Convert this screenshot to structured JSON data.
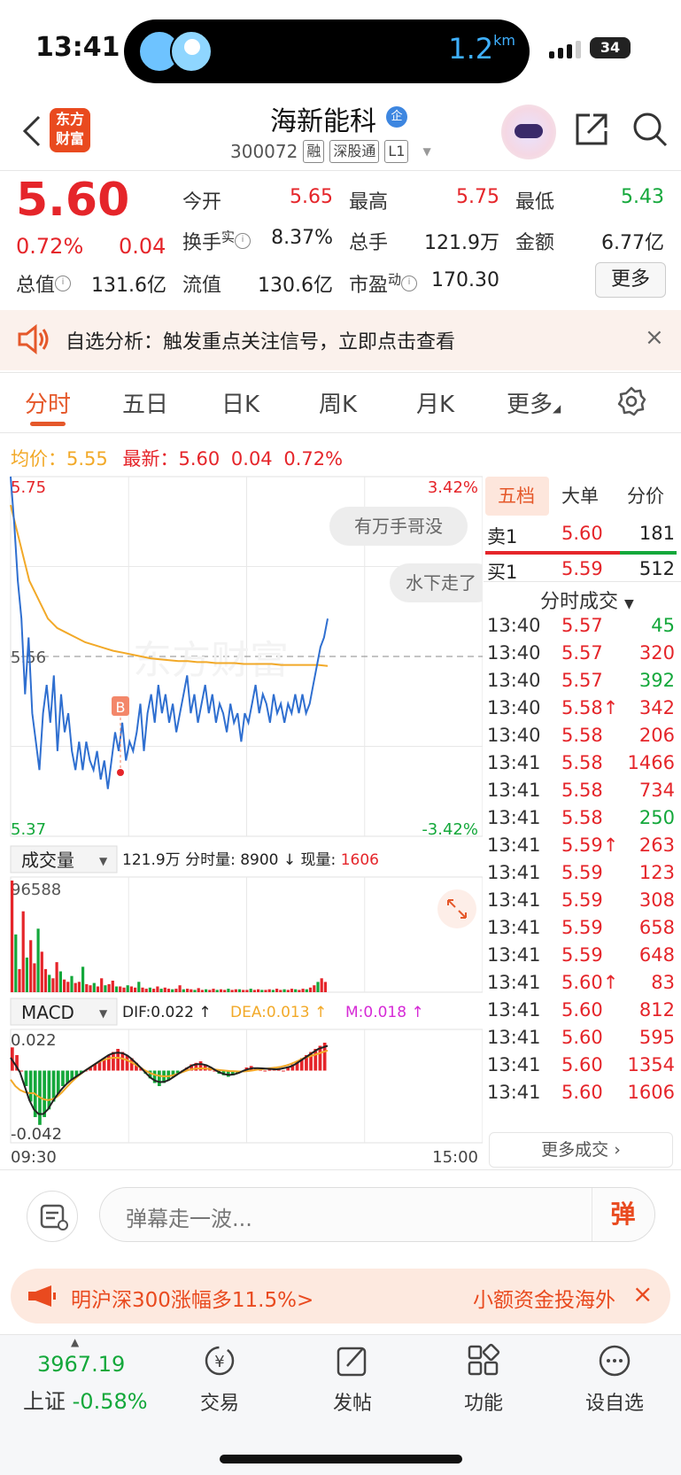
{
  "status_bar": {
    "time": "13:41",
    "distance": "1.2",
    "distance_unit": "km",
    "battery": "34"
  },
  "header": {
    "logo_text_1": "东方",
    "logo_text_2": "财富",
    "stock_name": "海新能科",
    "badge": "企",
    "stock_code": "300072",
    "tags": [
      "融",
      "深股通",
      "L1"
    ]
  },
  "quote": {
    "price": "5.60",
    "change_pct": "0.72%",
    "change_abs": "0.04",
    "open_label": "今开",
    "open": "5.65",
    "high_label": "最高",
    "high": "5.75",
    "low_label": "最低",
    "low": "5.43",
    "turnover_label": "换手",
    "turnover_sup": "实",
    "turnover": "8.37%",
    "volume_label": "总手",
    "volume": "121.9万",
    "amount_label": "金额",
    "amount": "6.77亿",
    "mktcap_label": "总值",
    "mktcap": "131.6亿",
    "float_label": "流值",
    "float": "130.6亿",
    "pe_label": "市盈",
    "pe_sup": "动",
    "pe": "170.30",
    "more_label": "更多"
  },
  "announcement": {
    "text": "自选分析：触发重点关注信号，立即点击查看",
    "close": "×"
  },
  "tabs": [
    "分时",
    "五日",
    "日K",
    "周K",
    "月K",
    "更多"
  ],
  "avg_line": {
    "avg_label": "均价：",
    "avg_value": "5.55",
    "latest_label": "最新：",
    "latest_value": "5.60",
    "latest_chg": "0.04",
    "latest_pct": "0.72%"
  },
  "chart_labels": {
    "price_top": "5.75",
    "price_mid": "5.56",
    "price_bottom": "5.37",
    "pct_top": "3.42%",
    "pct_bottom": "-3.42%",
    "danmu_1": "有万手哥没",
    "danmu_2": "水下走了",
    "watermark": "东方财富",
    "buy_marker": "B",
    "vol_selector": "成交量",
    "vol_total": "121.9万",
    "vol_fen_label": "分时量:",
    "vol_fen_value": "8900",
    "vol_now_label": "现量:",
    "vol_now_value": "1606",
    "vol_max": "96588",
    "macd_selector": "MACD",
    "dif": "DIF:0.022 ↑",
    "dea": "DEA:0.013 ↑",
    "m": "M:0.018 ↑",
    "macd_top": "0.022",
    "macd_bottom": "-0.042",
    "time_start": "09:30",
    "time_end": "15:00"
  },
  "order_book": {
    "tabs": [
      "五档",
      "大单",
      "分价"
    ],
    "sell1": {
      "label": "卖1",
      "price": "5.60",
      "volume": "181"
    },
    "buy1": {
      "label": "买1",
      "price": "5.59",
      "volume": "512"
    },
    "trades_title": "分时成交",
    "trades": [
      {
        "time": "13:40",
        "price": "5.57",
        "volume": "45",
        "dir": "sell"
      },
      {
        "time": "13:40",
        "price": "5.57",
        "volume": "320",
        "dir": "buy"
      },
      {
        "time": "13:40",
        "price": "5.57",
        "volume": "392",
        "dir": "sell"
      },
      {
        "time": "13:40",
        "price": "5.58↑",
        "volume": "342",
        "dir": "buy"
      },
      {
        "time": "13:40",
        "price": "5.58",
        "volume": "206",
        "dir": "buy"
      },
      {
        "time": "13:41",
        "price": "5.58",
        "volume": "1466",
        "dir": "buy"
      },
      {
        "time": "13:41",
        "price": "5.58",
        "volume": "734",
        "dir": "buy"
      },
      {
        "time": "13:41",
        "price": "5.58",
        "volume": "250",
        "dir": "sell"
      },
      {
        "time": "13:41",
        "price": "5.59↑",
        "volume": "263",
        "dir": "buy"
      },
      {
        "time": "13:41",
        "price": "5.59",
        "volume": "123",
        "dir": "buy"
      },
      {
        "time": "13:41",
        "price": "5.59",
        "volume": "308",
        "dir": "buy"
      },
      {
        "time": "13:41",
        "price": "5.59",
        "volume": "658",
        "dir": "buy"
      },
      {
        "time": "13:41",
        "price": "5.59",
        "volume": "648",
        "dir": "buy"
      },
      {
        "time": "13:41",
        "price": "5.60↑",
        "volume": "83",
        "dir": "buy"
      },
      {
        "time": "13:41",
        "price": "5.60",
        "volume": "812",
        "dir": "buy"
      },
      {
        "time": "13:41",
        "price": "5.60",
        "volume": "595",
        "dir": "buy"
      },
      {
        "time": "13:41",
        "price": "5.60",
        "volume": "1354",
        "dir": "buy"
      },
      {
        "time": "13:41",
        "price": "5.60",
        "volume": "1606",
        "dir": "buy"
      }
    ],
    "more_trades": "更多成交 ›"
  },
  "danmu": {
    "placeholder": "弹幕走一波...",
    "send": "弹"
  },
  "promo": {
    "text1": "明沪深300涨幅多11.5%>",
    "text2": "小额资金投海外",
    "close": "×"
  },
  "bottom_nav": {
    "index_value": "3967.19",
    "index_name": "上证",
    "index_change": "-0.58%",
    "items": [
      "交易",
      "发帖",
      "功能",
      "设自选"
    ]
  },
  "colors": {
    "up": "#e5252a",
    "down": "#14a83b",
    "price_line": "#2f6fd0",
    "avg_line": "#f2a928",
    "accent": "#e5582a"
  },
  "chart_data": [
    {
      "type": "line",
      "title": "",
      "x_label_start": "09:30",
      "x_label_end": "15:00",
      "ylim": [
        5.37,
        5.75
      ],
      "prev_close": 5.56,
      "series": [
        {
          "values": [
            5.75,
            5.7,
            5.64,
            5.6,
            5.52,
            5.58,
            5.5,
            5.47,
            5.44,
            5.5,
            5.53,
            5.49,
            5.54,
            5.46,
            5.52,
            5.48,
            5.5,
            5.46,
            5.44,
            5.47,
            5.44,
            5.47,
            5.45,
            5.44,
            5.46,
            5.43,
            5.45,
            5.42,
            5.45,
            5.48,
            5.46,
            5.49,
            5.45,
            5.47,
            5.46,
            5.48,
            5.51,
            5.46,
            5.5,
            5.52,
            5.49,
            5.53,
            5.5,
            5.52,
            5.49,
            5.51,
            5.48,
            5.5,
            5.52,
            5.54,
            5.5,
            5.52,
            5.49,
            5.51,
            5.53,
            5.5,
            5.52,
            5.49,
            5.51,
            5.5,
            5.48,
            5.51,
            5.49,
            5.5,
            5.47,
            5.5,
            5.49,
            5.51,
            5.53,
            5.5,
            5.52,
            5.51,
            5.49,
            5.52,
            5.5,
            5.51,
            5.49,
            5.51,
            5.5,
            5.52,
            5.5,
            5.52,
            5.5,
            5.51,
            5.53,
            5.55,
            5.57,
            5.58,
            5.6
          ]
        },
        {
          "values": [
            5.72,
            5.68,
            5.64,
            5.62,
            5.6,
            5.59,
            5.585,
            5.58,
            5.575,
            5.572,
            5.569,
            5.566,
            5.564,
            5.562,
            5.56,
            5.558,
            5.557,
            5.556,
            5.555,
            5.555,
            5.554,
            5.554,
            5.553,
            5.553,
            5.553,
            5.552,
            5.552,
            5.552,
            5.552,
            5.551,
            5.551,
            5.551,
            5.551,
            5.551,
            5.55
          ]
        }
      ]
    },
    {
      "type": "bar",
      "title": "",
      "ylim": [
        0,
        96588
      ],
      "values": [
        96588,
        50000,
        20000,
        70000,
        30000,
        45000,
        25000,
        55000,
        35000,
        20000,
        15000,
        12000,
        26000,
        18000,
        11000,
        9000,
        14000,
        8000,
        9000,
        22000,
        7000,
        6000,
        8000,
        5000,
        12000,
        6000,
        7000,
        10000,
        5000,
        5000,
        4000,
        6000,
        5000,
        4000,
        9000,
        4000,
        3000,
        4000,
        3000,
        5000,
        3000,
        4000,
        3000,
        2500,
        3000,
        6000,
        2500,
        3000,
        2500,
        2000,
        3500,
        2000,
        2500,
        2000,
        3000,
        2000,
        2500,
        2000,
        3000,
        2000,
        2500,
        2500,
        2000,
        2000,
        3000,
        2000,
        2500,
        2000,
        2000,
        2500,
        2000,
        3000,
        2000,
        2500,
        2000,
        3000,
        2500,
        2000,
        3000,
        2500,
        4000,
        6000,
        8900,
        12000,
        8900
      ]
    },
    {
      "type": "bar",
      "title": "",
      "ylim": [
        -0.042,
        0.022
      ],
      "values": [
        0.015,
        0.01,
        0.0,
        -0.01,
        -0.02,
        -0.03,
        -0.035,
        -0.03,
        -0.025,
        -0.02,
        -0.015,
        -0.01,
        -0.008,
        -0.006,
        -0.004,
        -0.002,
        0.0,
        0.002,
        0.004,
        0.006,
        0.008,
        0.01,
        0.012,
        0.014,
        0.012,
        0.01,
        0.008,
        0.005,
        0.002,
        -0.002,
        -0.005,
        -0.008,
        -0.01,
        -0.008,
        -0.006,
        -0.004,
        -0.002,
        0.0,
        0.002,
        0.004,
        0.005,
        0.006,
        0.004,
        0.002,
        0.0,
        -0.002,
        -0.003,
        -0.004,
        -0.003,
        -0.002,
        0.0,
        0.002,
        0.003,
        0.002,
        0.001,
        0.0,
        0.001,
        0.002,
        0.001,
        0.0,
        0.002,
        0.004,
        0.006,
        0.008,
        0.01,
        0.012,
        0.014,
        0.016,
        0.018
      ]
    }
  ]
}
